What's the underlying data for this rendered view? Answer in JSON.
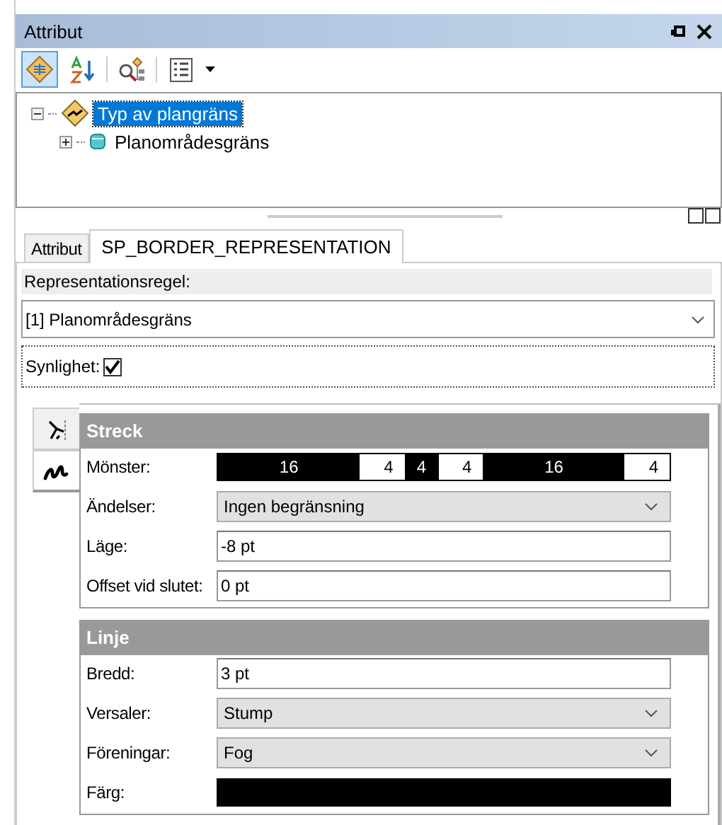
{
  "window": {
    "title": "Attribut",
    "buttons": [
      {
        "kind": "pin"
      },
      {
        "kind": "close"
      }
    ]
  },
  "toolbar": [
    {
      "kind": "categorized",
      "selected": true
    },
    {
      "kind": "sort",
      "selected": false
    },
    {
      "kind": "query",
      "selected": false
    },
    {
      "kind": "list",
      "selected": false
    }
  ],
  "tree": [
    {
      "label": "Typ av plangräns",
      "kind": "representation",
      "expanded": true,
      "selected": true,
      "children": [
        {
          "label": "Planområdesgräns",
          "kind": "feature",
          "expanded": false,
          "selected": false
        }
      ]
    }
  ],
  "tabs": [
    {
      "label": "Attribut",
      "selected": false
    },
    {
      "label": "SP_BORDER_REPRESENTATION",
      "selected": true
    }
  ],
  "rule": {
    "label": "Representationsregel:",
    "value": "[1] Planområdesgräns"
  },
  "visibility": {
    "label": "Synlighet:",
    "checked": true
  },
  "side_tabs": [
    {
      "kind": "effects",
      "selected": false
    },
    {
      "kind": "stroke",
      "selected": true
    }
  ],
  "groups": [
    {
      "title": "Streck",
      "rows": [
        {
          "kind": "pattern",
          "label": "Mönster:",
          "segments": [
            {
              "kind": "dash",
              "value": "16"
            },
            {
              "kind": "gap",
              "value": "4"
            },
            {
              "kind": "dash",
              "value": "4"
            },
            {
              "kind": "gap",
              "value": "4"
            },
            {
              "kind": "dash",
              "value": "16"
            },
            {
              "kind": "gap",
              "value": "4"
            }
          ]
        },
        {
          "kind": "dropdown",
          "label": "Ändelser:",
          "value": "Ingen begränsning"
        },
        {
          "kind": "text",
          "label": "Läge:",
          "value": "-8 pt"
        },
        {
          "kind": "text",
          "label": "Offset vid slutet:",
          "value": "0 pt"
        }
      ]
    },
    {
      "title": "Linje",
      "rows": [
        {
          "kind": "text",
          "label": "Bredd:",
          "value": "3 pt"
        },
        {
          "kind": "dropdown",
          "label": "Versaler:",
          "value": "Stump"
        },
        {
          "kind": "dropdown",
          "label": "Föreningar:",
          "value": "Fog"
        },
        {
          "kind": "color",
          "label": "Färg:",
          "color": "#000000"
        }
      ]
    }
  ]
}
